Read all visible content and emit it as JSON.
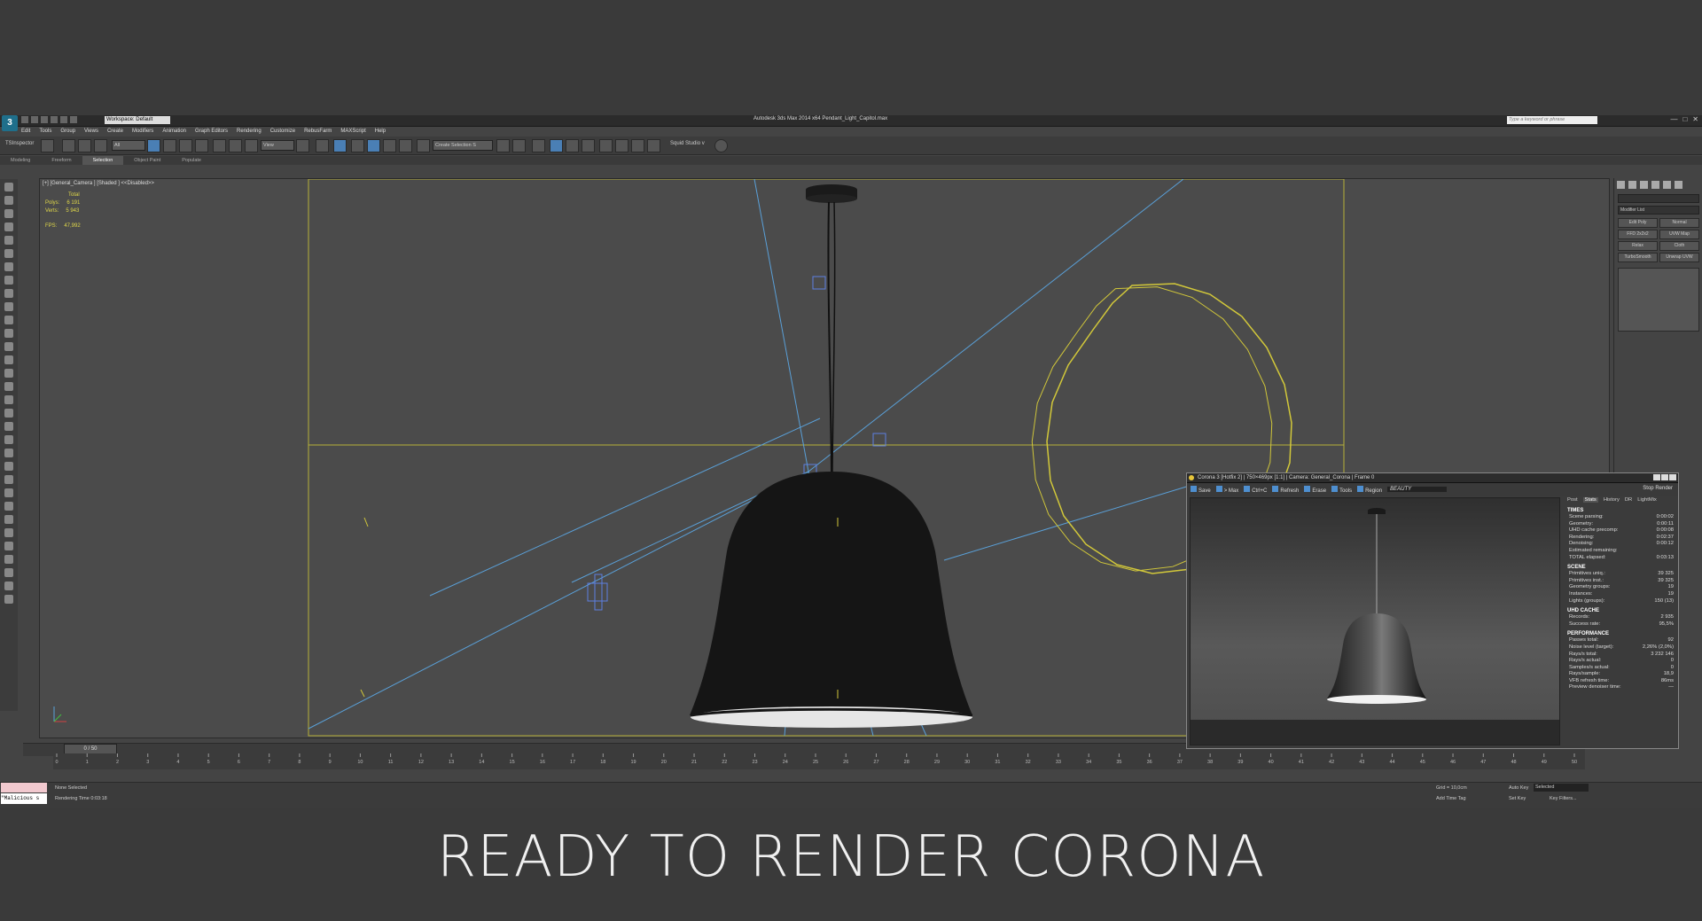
{
  "titlebar": {
    "workspace": "Workspace: Default",
    "title": "Autodesk 3ds Max  2014 x64    Pendant_Light_Capitol.max",
    "search_placeholder": "Type a keyword or phrase"
  },
  "menu": [
    "Edit",
    "Tools",
    "Group",
    "Views",
    "Create",
    "Modifiers",
    "Animation",
    "Graph Editors",
    "Rendering",
    "Customize",
    "RebusFarm",
    "MAXScript",
    "Help"
  ],
  "toolbar": {
    "ts_inspector": "TSInspector",
    "filter_all": "All",
    "view": "View",
    "create_selection": "Create Selection S",
    "squid_studio": "Squid Studio v"
  },
  "ribbon_tabs": [
    "Modeling",
    "Freeform",
    "Selection",
    "Object Paint",
    "Populate"
  ],
  "ribbon_active": "Selection",
  "viewport": {
    "label": "[+] [General_Camera ] [Shaded ]  <<Disabled>>",
    "stats": {
      "total_label": "Total",
      "polys_label": "Polys:",
      "polys_value": "6 191",
      "verts_label": "Verts:",
      "verts_value": "5 943",
      "fps_label": "FPS:",
      "fps_value": "47,992"
    }
  },
  "command_panel": {
    "modifier_list": "Modifier List",
    "buttons": [
      "Edit Poly",
      "Normal",
      "FFD 2x2x2",
      "UVW Map",
      "Relax",
      "Cloth",
      "TurboSmooth",
      "Unwrap UVW"
    ]
  },
  "timeline": {
    "frame_slider": "0 / 50",
    "ticks": [
      "0",
      "1",
      "2",
      "3",
      "4",
      "5",
      "6",
      "7",
      "8",
      "9",
      "10",
      "11",
      "12",
      "13",
      "14",
      "15",
      "16",
      "17",
      "18",
      "19",
      "20",
      "21",
      "22",
      "23",
      "24",
      "25",
      "26",
      "27",
      "28",
      "29",
      "30",
      "31",
      "32",
      "33",
      "34",
      "35",
      "36",
      "37",
      "38",
      "39",
      "40",
      "41",
      "42",
      "43",
      "44",
      "45",
      "46",
      "47",
      "48",
      "49",
      "50"
    ]
  },
  "status": {
    "maxscript": "\"Malicious s",
    "selection": "None Selected",
    "render_time": "Rendering Time  0:03:18",
    "grid": "Grid = 10,0cm",
    "add_time_tag": "Add Time Tag",
    "auto_key": "Auto Key",
    "auto_key_mode": "Selected",
    "set_key": "Set Key",
    "key_filters": "Key Filters..."
  },
  "vfb": {
    "title": "Corona 3 [Hotfix 2]  | 750×469px [1:1]  | Camera: General_Corona  | Frame 0",
    "tools": [
      "Save",
      "> Max",
      "Ctrl+C",
      "Refresh",
      "Erase",
      "Tools",
      "Region"
    ],
    "channel": "BEAUTY",
    "stop": "Stop",
    "render": "Render",
    "tabs": [
      "Post",
      "Stats",
      "History",
      "DR",
      "LightMix"
    ],
    "active_tab": "Stats",
    "sections": [
      {
        "title": "TIMES",
        "rows": [
          [
            "Scene parsing:",
            "0:00:02"
          ],
          [
            "Geometry:",
            "0:00:11"
          ],
          [
            "UHD cache precomp:",
            "0:00:08"
          ],
          [
            "Rendering:",
            "0:02:37"
          ],
          [
            "Denoising:",
            "0:00:12"
          ],
          [
            "Estimated remaining:",
            ""
          ],
          [
            "TOTAL elapsed:",
            "0:03:13"
          ]
        ]
      },
      {
        "title": "SCENE",
        "rows": [
          [
            "Primitives uniq.:",
            "39 325"
          ],
          [
            "Primitives inst.:",
            "39 325"
          ],
          [
            "Geometry groups:",
            "19"
          ],
          [
            "Instances:",
            "19"
          ],
          [
            "Lights (groups):",
            "150 (13)"
          ]
        ]
      },
      {
        "title": "UHD CACHE",
        "rows": [
          [
            "Records:",
            "2 935"
          ],
          [
            "Success rate:",
            "95,5%"
          ]
        ]
      },
      {
        "title": "PERFORMANCE",
        "rows": [
          [
            "Passes total:",
            "92"
          ],
          [
            "Noise level (target):",
            "2,26% (2,0%)"
          ],
          [
            "Rays/s total:",
            "3 232 146"
          ],
          [
            "Rays/s actual:",
            "0"
          ],
          [
            "Samples/s actual:",
            "0"
          ],
          [
            "Rays/sample:",
            "18,9"
          ],
          [
            "VFB refresh time:",
            "86ms"
          ],
          [
            "Preview denoiser time:",
            "—"
          ]
        ]
      }
    ]
  },
  "caption": "READY TO RENDER CORONA",
  "colors": {
    "accent": "#4a7fb5",
    "selection_yellow": "#b7b23a",
    "light_blue": "#5aa0d8"
  }
}
